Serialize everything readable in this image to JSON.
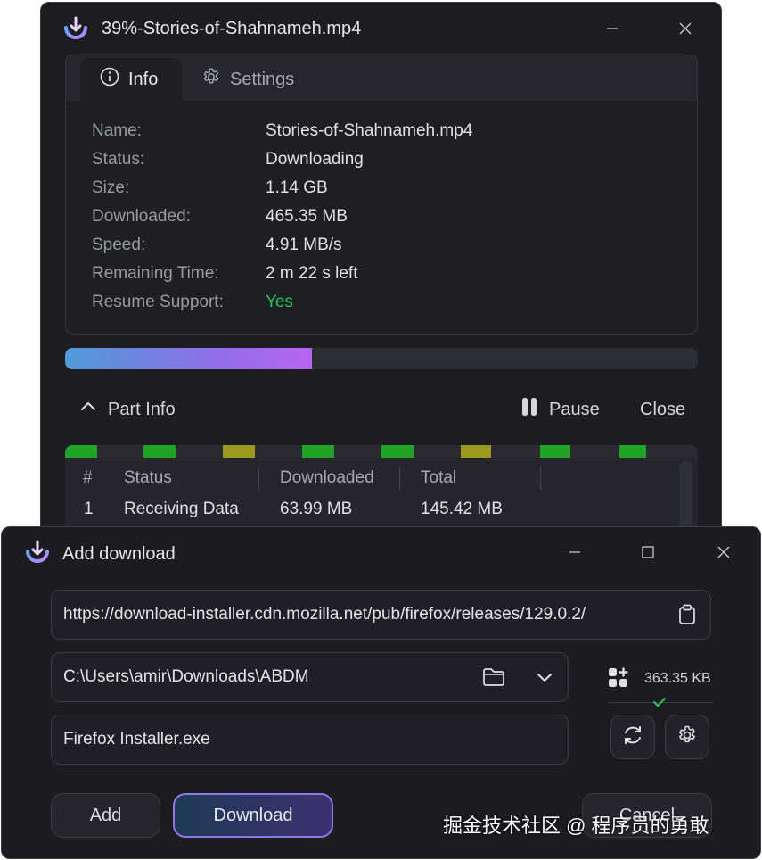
{
  "progress_window": {
    "title": "39%-Stories-of-Shahnameh.mp4",
    "tabs": [
      {
        "label": "Info",
        "icon": "info-icon",
        "active": true
      },
      {
        "label": "Settings",
        "icon": "gear-icon",
        "active": false
      }
    ],
    "info": {
      "name_label": "Name:",
      "name_value": "Stories-of-Shahnameh.mp4",
      "status_label": "Status:",
      "status_value": "Downloading",
      "size_label": "Size:",
      "size_value": "1.14 GB",
      "downloaded_label": "Downloaded:",
      "downloaded_value": "465.35 MB",
      "speed_label": "Speed:",
      "speed_value": "4.91 MB/s",
      "remaining_label": "Remaining Time:",
      "remaining_value": "2 m 22 s left",
      "resume_label": "Resume Support:",
      "resume_value": "Yes"
    },
    "progress_fraction": 0.39,
    "part_info": {
      "toggle_label": "Part Info",
      "pause_label": "Pause",
      "close_label": "Close",
      "segment_colors": [
        "#1fa327",
        "#9a9a1e"
      ],
      "columns": [
        "#",
        "Status",
        "Downloaded",
        "Total"
      ],
      "rows": [
        {
          "num": "1",
          "status": "Receiving Data",
          "downloaded": "63.99 MB",
          "total": "145.42 MB"
        }
      ]
    }
  },
  "add_window": {
    "title": "Add download",
    "url": "https://download-installer.cdn.mozilla.net/pub/firefox/releases/129.0.2/",
    "folder": "C:\\Users\\amir\\Downloads\\ABDM",
    "file_size": "363.35 KB",
    "file_name": "Firefox Installer.exe",
    "add_label": "Add",
    "download_label": "Download",
    "cancel_label": "Cancel"
  },
  "watermark": "掘金技术社区 @ 程序员的勇敢",
  "colors": {
    "accent": "#b765f2",
    "success": "#22c55e",
    "background": "#1c1c21"
  }
}
